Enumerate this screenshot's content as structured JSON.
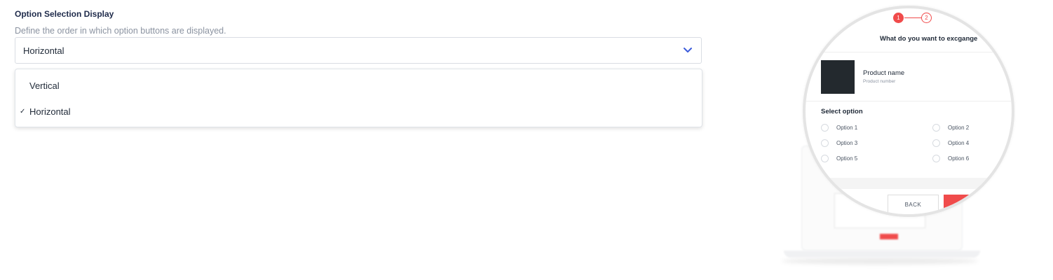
{
  "field": {
    "title": "Option Selection Display",
    "description": "Define the order in which option buttons are displayed."
  },
  "select": {
    "value": "Horizontal",
    "expanded": true,
    "icon": "chevron-down-icon",
    "accent_color": "#3b5bdb"
  },
  "dropdown": {
    "options": [
      {
        "label": "Vertical",
        "selected": false
      },
      {
        "label": "Horizontal",
        "selected": true
      }
    ],
    "check_mark": "✓"
  },
  "preview": {
    "steps": [
      "1",
      "2"
    ],
    "question": "What do you want to excgange",
    "product_name": "Product name",
    "product_number": "Product number",
    "select_option_title": "Select option",
    "options": [
      "Option 1",
      "Option 2",
      "Option 3",
      "Option 4",
      "Option 5",
      "Option 6"
    ],
    "back_label": "BACK",
    "accent_color": "#f04b4b"
  }
}
